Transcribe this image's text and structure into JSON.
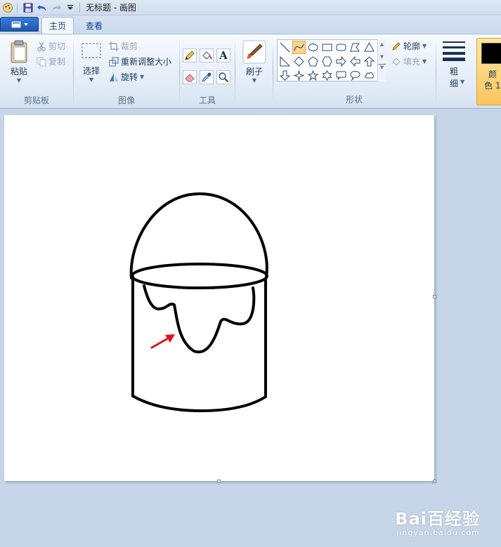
{
  "window": {
    "title": "无标题 - 画图"
  },
  "tabs": [
    {
      "label": "主页",
      "active": true
    },
    {
      "label": "查看",
      "active": false
    }
  ],
  "ribbon": {
    "clipboard": {
      "group_label": "剪贴板",
      "paste": "粘贴",
      "cut": "剪切",
      "copy": "复制"
    },
    "image": {
      "group_label": "图像",
      "select": "选择",
      "crop": "裁剪",
      "resize": "重新调整大小",
      "rotate": "旋转"
    },
    "tools": {
      "group_label": "工具"
    },
    "brushes": {
      "label": "刷子"
    },
    "shapes": {
      "group_label": "形状",
      "outline": "轮廓",
      "fill": "填充"
    },
    "size": {
      "label_line1": "粗",
      "label_line2": "细"
    },
    "color1": {
      "label_line1": "颜",
      "label_line2": "色 1",
      "value": "#000000"
    }
  },
  "watermark": {
    "main": "Bai百经验",
    "sub": "jingyan.baidu.com"
  },
  "colors": {
    "accent": "#1d57b0",
    "ribbon_bg": "#dde8f5",
    "workspace": "#c7d5e8",
    "arrow": "#e0141e"
  }
}
